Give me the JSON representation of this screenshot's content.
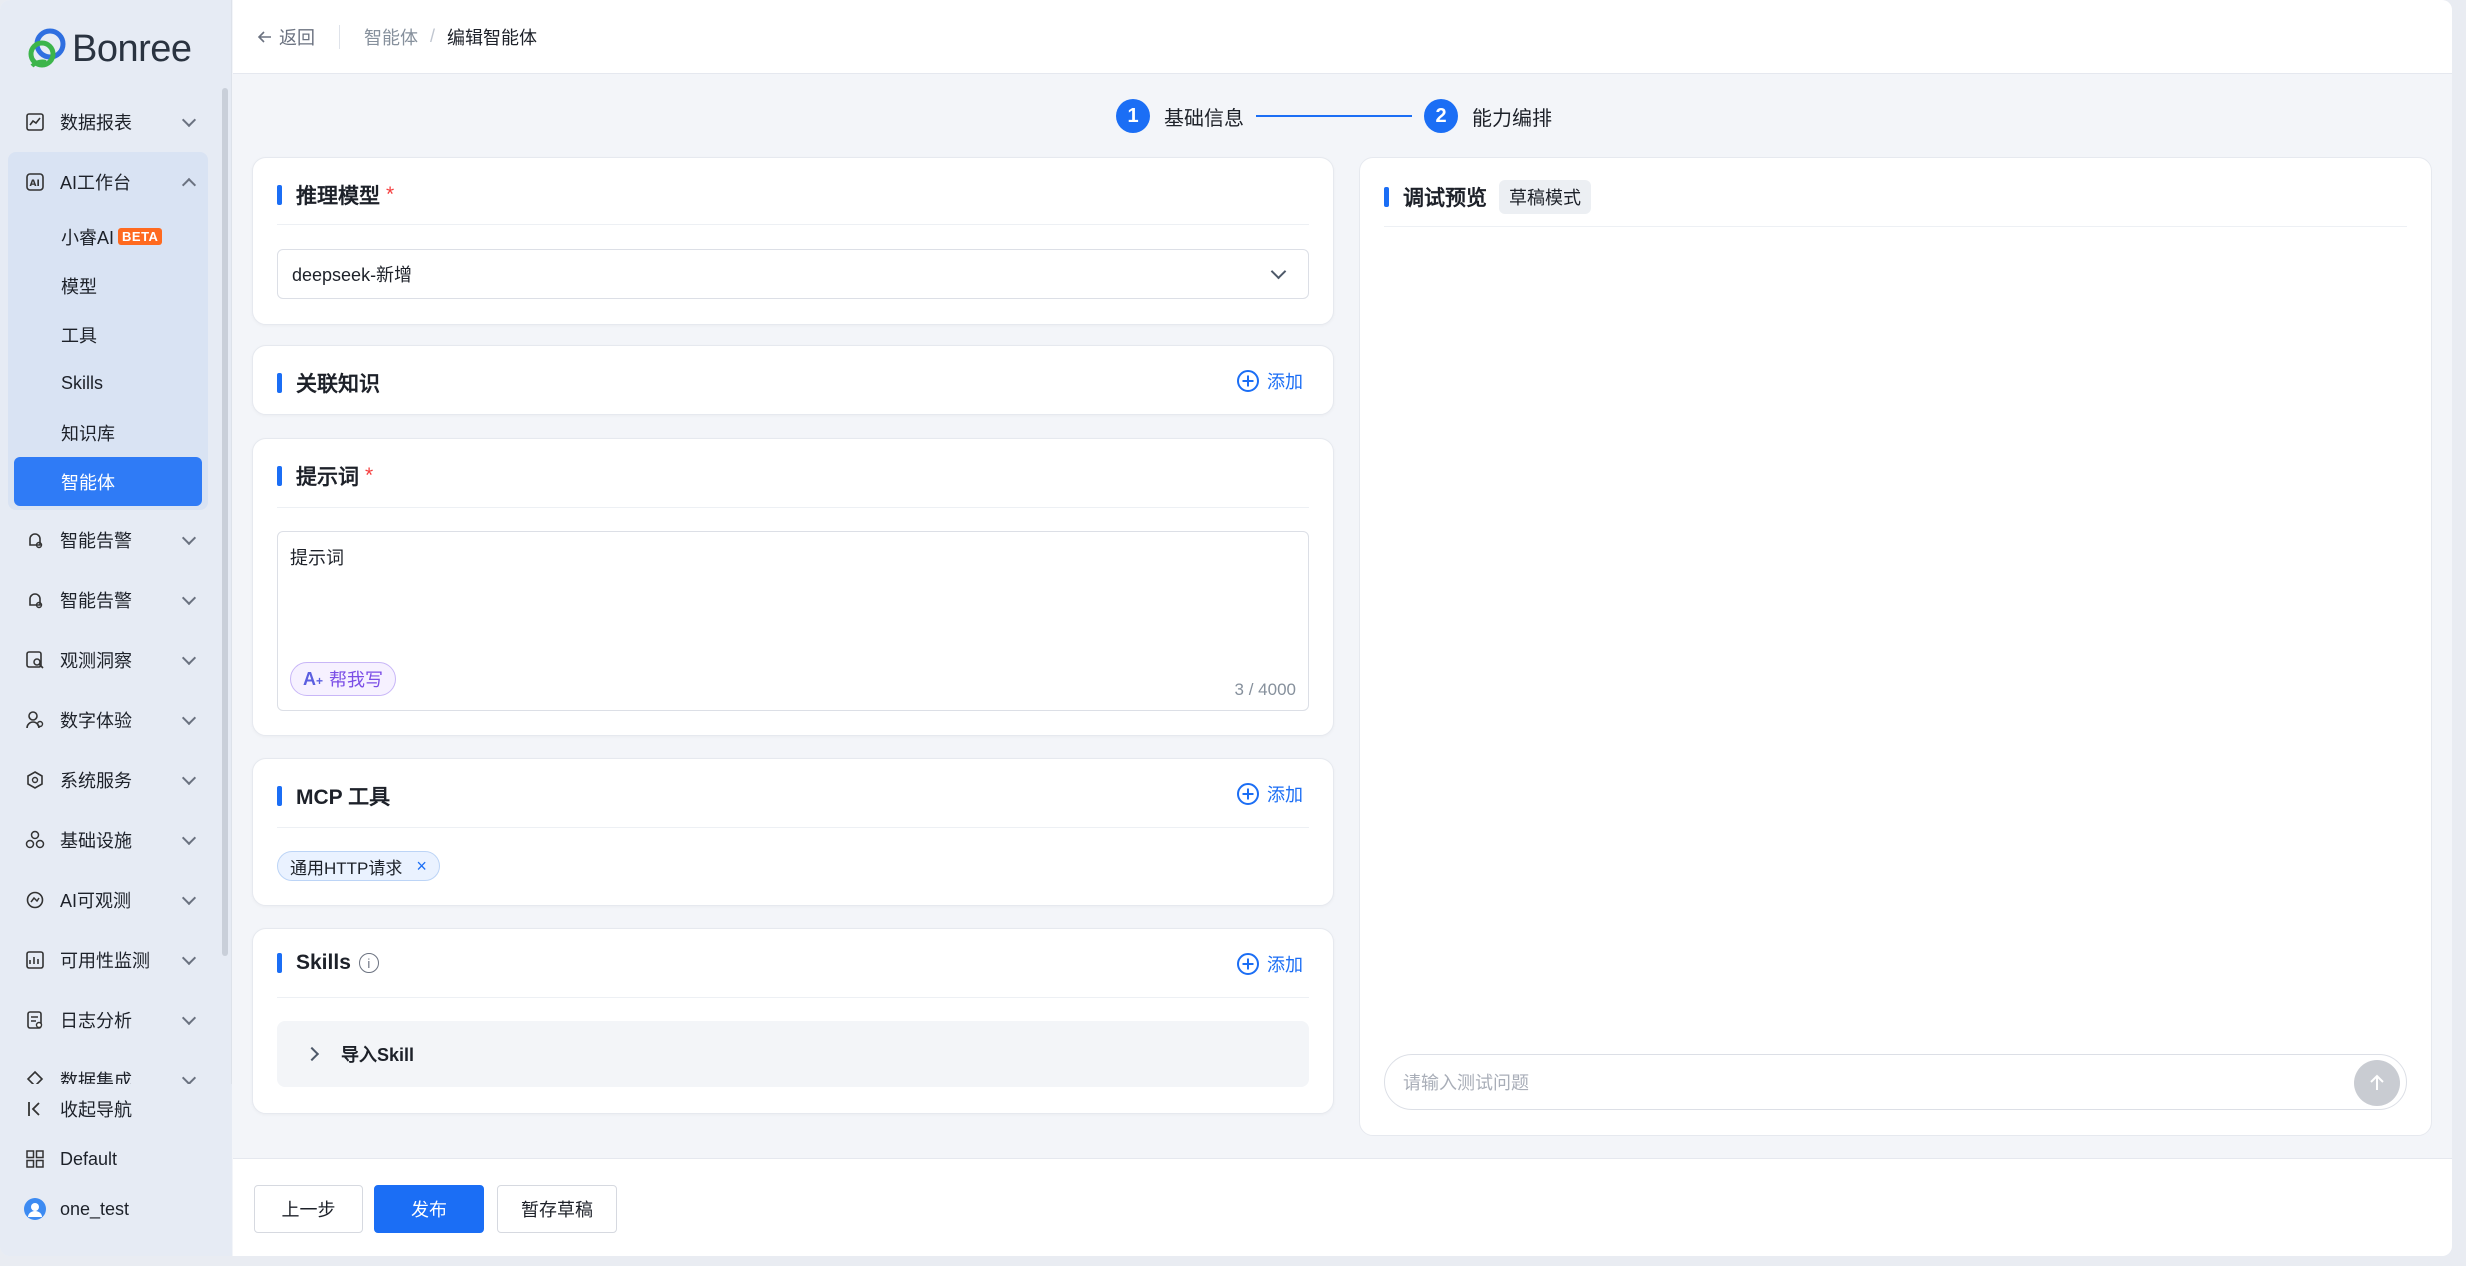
{
  "app": {
    "logo_text": "Bonree"
  },
  "sidebar": {
    "items": [
      {
        "label": "数据报表",
        "icon": "chart-line-icon"
      },
      {
        "label": "AI工作台",
        "icon": "ai-icon"
      },
      {
        "label": "智能告警",
        "icon": "alert-bell-icon"
      },
      {
        "label": "智能告警",
        "icon": "alert-bell-icon"
      },
      {
        "label": "观测洞察",
        "icon": "search-doc-icon"
      },
      {
        "label": "数字体验",
        "icon": "user-experience-icon"
      },
      {
        "label": "系统服务",
        "icon": "system-service-icon"
      },
      {
        "label": "基础设施",
        "icon": "infrastructure-icon"
      },
      {
        "label": "AI可观测",
        "icon": "ai-observe-icon"
      },
      {
        "label": "可用性监测",
        "icon": "availability-icon"
      },
      {
        "label": "日志分析",
        "icon": "log-icon"
      },
      {
        "label": "数据集成",
        "icon": "data-integration-icon"
      }
    ],
    "ai_sub": [
      {
        "label": "小睿AI",
        "badge": "BETA"
      },
      {
        "label": "模型"
      },
      {
        "label": "工具"
      },
      {
        "label": "Skills"
      },
      {
        "label": "知识库"
      },
      {
        "label": "智能体"
      }
    ],
    "bottom": {
      "collapse": "收起导航",
      "workspace": "Default",
      "user": "one_test"
    }
  },
  "header": {
    "back": "返回",
    "crumb1": "智能体",
    "crumb_sep": "/",
    "crumb2": "编辑智能体"
  },
  "steps": [
    {
      "num": "1",
      "label": "基础信息"
    },
    {
      "num": "2",
      "label": "能力编排"
    }
  ],
  "model": {
    "title": "推理模型",
    "required": "*",
    "value": "deepseek-新增"
  },
  "knowledge": {
    "title": "关联知识",
    "add": "添加"
  },
  "prompt": {
    "title": "提示词",
    "required": "*",
    "value": "提示词",
    "help": "帮我写",
    "count": "3 / 4000"
  },
  "mcp": {
    "title": "MCP 工具",
    "add": "添加",
    "tag": "通用HTTP请求",
    "remove": "×"
  },
  "skills": {
    "title": "Skills",
    "add": "添加",
    "import": "导入Skill",
    "info": "i"
  },
  "preview": {
    "title": "调试预览",
    "badge": "草稿模式",
    "input_placeholder": "请输入测试问题"
  },
  "footer": {
    "prev": "上一步",
    "publish": "发布",
    "save_draft": "暂存草稿"
  },
  "colors": {
    "primary": "#1b6ef5",
    "required": "#f53f3f",
    "beta": "#ff6a1f"
  }
}
